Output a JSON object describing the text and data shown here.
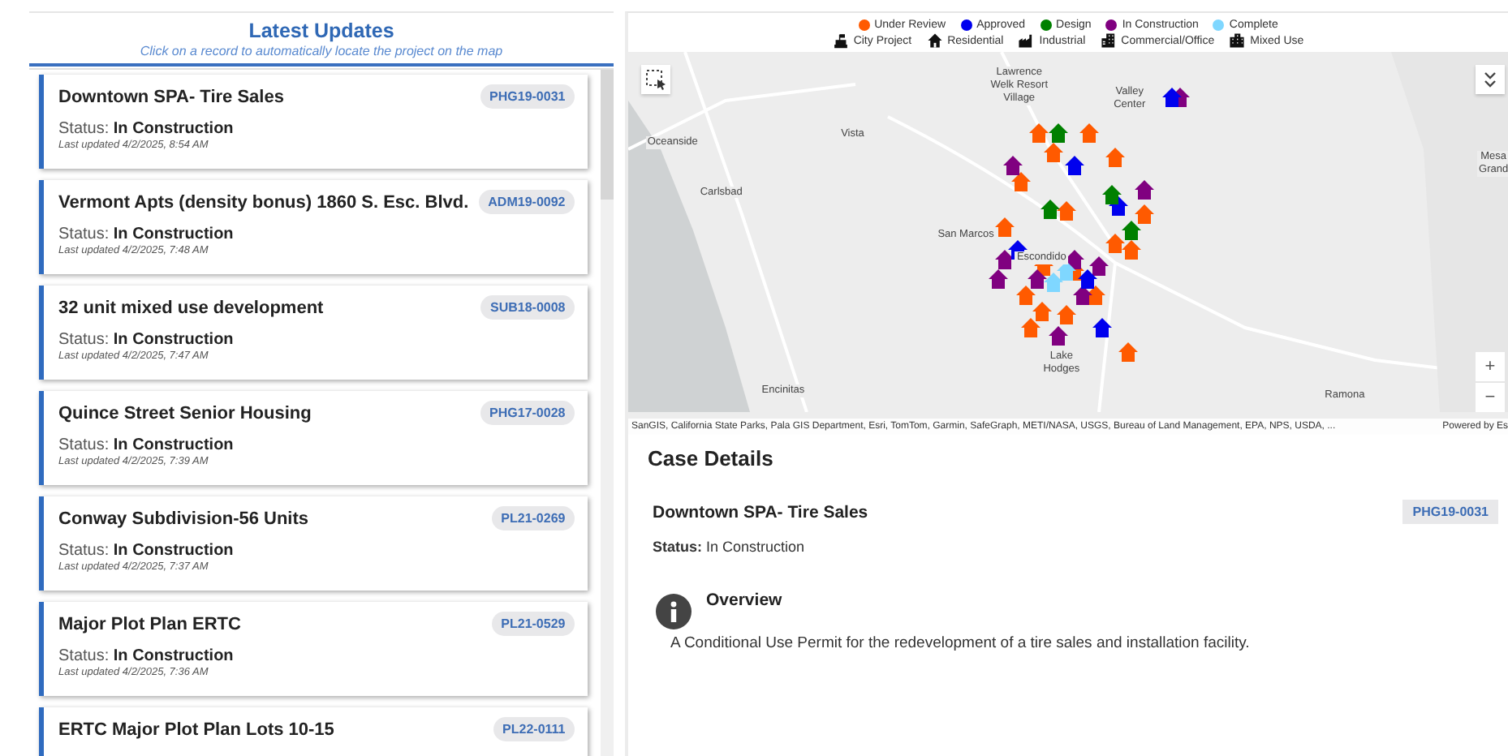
{
  "list_panel": {
    "title": "Latest Updates",
    "subtitle": "Click on a record to automatically locate the project on the map"
  },
  "records": [
    {
      "title": "Downtown SPA- Tire Sales",
      "case_id": "PHG19-0031",
      "status_label": "Status:",
      "status": "In Construction",
      "updated": "Last updated 4/2/2025, 8:54 AM"
    },
    {
      "title": "Vermont Apts (density bonus) 1860 S. Esc. Blvd.",
      "case_id": "ADM19-0092",
      "status_label": "Status:",
      "status": "In Construction",
      "updated": "Last updated 4/2/2025, 7:48 AM"
    },
    {
      "title": "32 unit mixed use development",
      "case_id": "SUB18-0008",
      "status_label": "Status:",
      "status": "In Construction",
      "updated": "Last updated 4/2/2025, 7:47 AM"
    },
    {
      "title": "Quince Street Senior Housing",
      "case_id": "PHG17-0028",
      "status_label": "Status:",
      "status": "In Construction",
      "updated": "Last updated 4/2/2025, 7:39 AM"
    },
    {
      "title": "Conway Subdivision-56 Units",
      "case_id": "PL21-0269",
      "status_label": "Status:",
      "status": "In Construction",
      "updated": "Last updated 4/2/2025, 7:37 AM"
    },
    {
      "title": "Major Plot Plan ERTC",
      "case_id": "PL21-0529",
      "status_label": "Status:",
      "status": "In Construction",
      "updated": "Last updated 4/2/2025, 7:36 AM"
    },
    {
      "title": "ERTC Major Plot Plan Lots 10-15",
      "case_id": "PL22-0111"
    }
  ],
  "legend": {
    "statuses": [
      {
        "label": "Under Review",
        "color": "#ff5a00"
      },
      {
        "label": "Approved",
        "color": "#0000ee"
      },
      {
        "label": "Design",
        "color": "#008000"
      },
      {
        "label": "In Construction",
        "color": "#800080"
      },
      {
        "label": "Complete",
        "color": "#7fd7ff"
      }
    ],
    "types": [
      {
        "label": "City Project",
        "kind": "city"
      },
      {
        "label": "Residential",
        "kind": "residential"
      },
      {
        "label": "Industrial",
        "kind": "industrial"
      },
      {
        "label": "Commercial/Office",
        "kind": "commercial"
      },
      {
        "label": "Mixed Use",
        "kind": "mixed"
      }
    ]
  },
  "map": {
    "places": [
      {
        "label": "Lawrence\nWelk Resort\nVillage"
      },
      {
        "label": "Valley\nCenter"
      },
      {
        "label": "Oceanside"
      },
      {
        "label": "Vista"
      },
      {
        "label": "Carlsbad"
      },
      {
        "label": "San Marcos"
      },
      {
        "label": "Escondido"
      },
      {
        "label": "Lake\nHodges"
      },
      {
        "label": "Encinitas"
      },
      {
        "label": "Ramona"
      },
      {
        "label": "Mesa\nGrand"
      }
    ],
    "attribution": "SanGIS, California State Parks, Pala GIS Department, Esri, TomTom, Garmin, SafeGraph, METI/NASA, USGS, Bureau of Land Management, EPA, NPS, USDA, ...",
    "powered_by": "Powered by Es",
    "zoom_in": "+",
    "zoom_out": "−"
  },
  "case_details": {
    "heading": "Case Details",
    "title": "Downtown SPA- Tire Sales",
    "case_id": "PHG19-0031",
    "status_label": "Status:",
    "status": "In Construction",
    "overview_heading": "Overview",
    "overview": "A Conditional Use Permit for the redevelopment of a tire sales and installation facility."
  }
}
